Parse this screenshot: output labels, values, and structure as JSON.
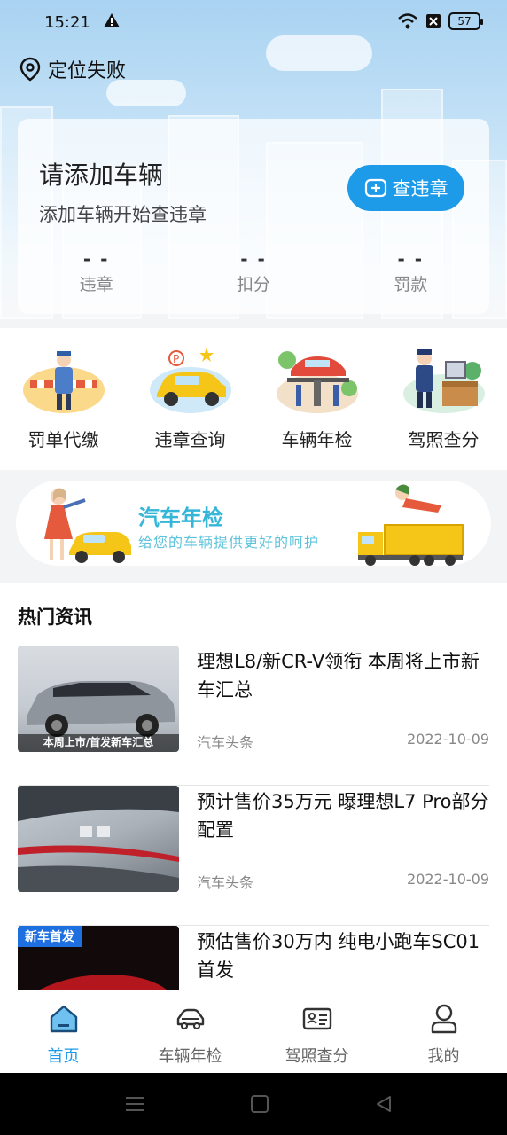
{
  "status_bar": {
    "time": "15:21",
    "battery": "57"
  },
  "location": {
    "label": "定位失败"
  },
  "vehicle_card": {
    "title": "请添加车辆",
    "subtitle": "添加车辆开始查违章",
    "check_button": "查违章",
    "stats": [
      {
        "value": "- -",
        "label": "违章"
      },
      {
        "value": "- -",
        "label": "扣分"
      },
      {
        "value": "- -",
        "label": "罚款"
      }
    ]
  },
  "services": [
    {
      "label": "罚单代缴",
      "icon": "police-officer-icon"
    },
    {
      "label": "违章查询",
      "icon": "car-parking-icon"
    },
    {
      "label": "车辆年检",
      "icon": "car-lift-icon"
    },
    {
      "label": "驾照查分",
      "icon": "license-officer-icon"
    }
  ],
  "banner": {
    "title": "汽车年检",
    "subtitle": "给您的车辆提供更好的呵护"
  },
  "news": {
    "section_title": "热门资讯",
    "items": [
      {
        "title": "理想L8/新CR-V领衔 本周将上市新车汇总",
        "source": "汽车头条",
        "date": "2022-10-09",
        "thumb_caption": "本周上市/首发新车汇总"
      },
      {
        "title": "预计售价35万元 曝理想L7 Pro部分配置",
        "source": "汽车头条",
        "date": "2022-10-09"
      },
      {
        "title": "预估售价30万内 纯电小跑车SC01首发",
        "badge": "新车首发"
      }
    ]
  },
  "tabbar": [
    {
      "label": "首页",
      "icon": "home-icon",
      "active": true
    },
    {
      "label": "车辆年检",
      "icon": "car-icon",
      "active": false
    },
    {
      "label": "驾照查分",
      "icon": "id-card-icon",
      "active": false
    },
    {
      "label": "我的",
      "icon": "user-icon",
      "active": false
    }
  ],
  "colors": {
    "accent": "#1e9be8",
    "banner_text": "#34b6d8"
  }
}
